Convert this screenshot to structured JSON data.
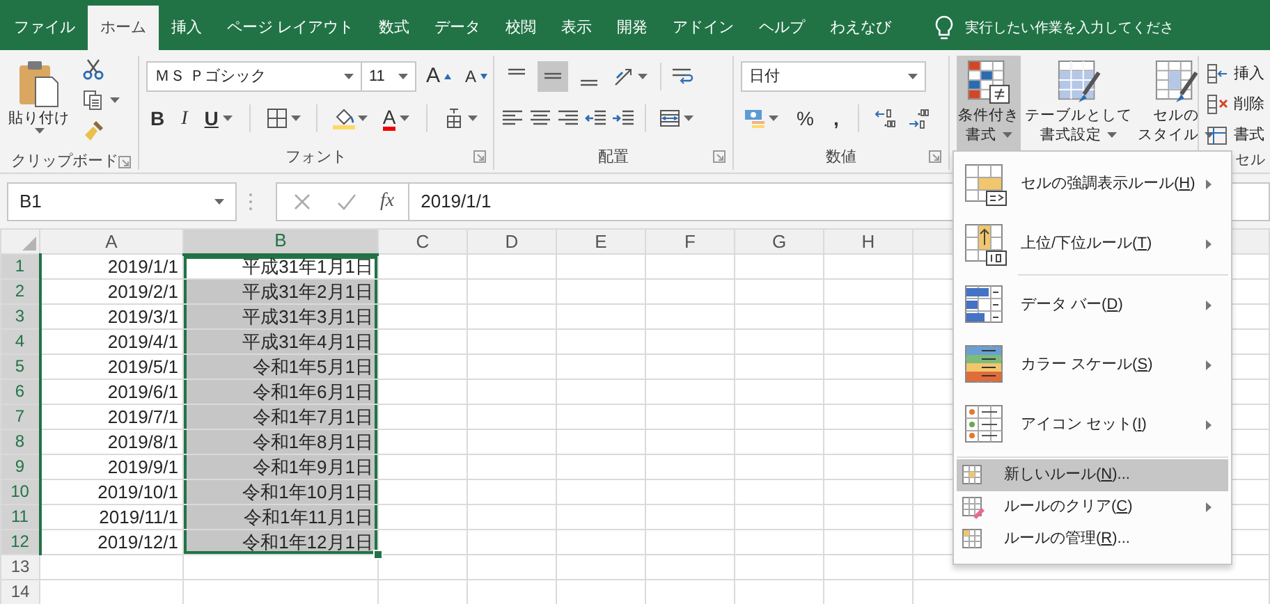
{
  "tabs": [
    {
      "label": "ファイル",
      "selected": false
    },
    {
      "label": "ホーム",
      "selected": true
    },
    {
      "label": "挿入",
      "selected": false
    },
    {
      "label": "ページ レイアウト",
      "selected": false
    },
    {
      "label": "数式",
      "selected": false
    },
    {
      "label": "データ",
      "selected": false
    },
    {
      "label": "校閲",
      "selected": false
    },
    {
      "label": "表示",
      "selected": false
    },
    {
      "label": "開発",
      "selected": false
    },
    {
      "label": "アドイン",
      "selected": false
    },
    {
      "label": "ヘルプ",
      "selected": false
    },
    {
      "label": "わえなび",
      "selected": false
    }
  ],
  "tell_me": {
    "placeholder": "実行したい作業を入力してくださ"
  },
  "ribbon": {
    "clipboard": {
      "paste": "貼り付け",
      "label": "クリップボード"
    },
    "font": {
      "font_name": "ＭＳ Ｐゴシック",
      "font_size": "11",
      "grow": "A",
      "shrink": "A",
      "bold": "B",
      "italic": "I",
      "underline": "U",
      "font_color": "A",
      "label": "フォント"
    },
    "alignment": {
      "vertical": [
        {
          "pressed": false
        },
        {
          "pressed": true
        },
        {
          "pressed": false
        }
      ],
      "label": "配置"
    },
    "number": {
      "format": "日付",
      "percent": "%",
      "comma": ",",
      "label": "数値"
    },
    "styles": {
      "buttons": [
        {
          "lines": [
            "条件付き",
            "書式"
          ],
          "pressed": true
        },
        {
          "lines": [
            "テーブルとして",
            "書式設定"
          ],
          "pressed": false
        },
        {
          "lines": [
            "セルの",
            "スタイル"
          ],
          "pressed": false
        }
      ]
    },
    "cells": {
      "items": [
        "挿入",
        "削除",
        "書式"
      ],
      "label": "セル"
    }
  },
  "formula_bar": {
    "name_box": "B1",
    "function_button": "fx",
    "value": "2019/1/1"
  },
  "sheet": {
    "columns": [
      {
        "label": "A",
        "selected": false
      },
      {
        "label": "B",
        "selected": true
      },
      {
        "label": "C",
        "selected": false
      },
      {
        "label": "D",
        "selected": false
      },
      {
        "label": "E",
        "selected": false
      },
      {
        "label": "F",
        "selected": false
      },
      {
        "label": "G",
        "selected": false
      },
      {
        "label": "H",
        "selected": false
      }
    ],
    "rows": [
      {
        "header": "1",
        "selected": true,
        "cells": [
          {
            "text": "2019/1/1",
            "selected": false
          },
          {
            "text": "平成31年1月1日",
            "selected": false
          }
        ]
      },
      {
        "header": "2",
        "selected": true,
        "cells": [
          {
            "text": "2019/2/1",
            "selected": false
          },
          {
            "text": "平成31年2月1日",
            "selected": true
          }
        ]
      },
      {
        "header": "3",
        "selected": true,
        "cells": [
          {
            "text": "2019/3/1",
            "selected": false
          },
          {
            "text": "平成31年3月1日",
            "selected": true
          }
        ]
      },
      {
        "header": "4",
        "selected": true,
        "cells": [
          {
            "text": "2019/4/1",
            "selected": false
          },
          {
            "text": "平成31年4月1日",
            "selected": true
          }
        ]
      },
      {
        "header": "5",
        "selected": true,
        "cells": [
          {
            "text": "2019/5/1",
            "selected": false
          },
          {
            "text": "令和1年5月1日",
            "selected": true
          }
        ]
      },
      {
        "header": "6",
        "selected": true,
        "cells": [
          {
            "text": "2019/6/1",
            "selected": false
          },
          {
            "text": "令和1年6月1日",
            "selected": true
          }
        ]
      },
      {
        "header": "7",
        "selected": true,
        "cells": [
          {
            "text": "2019/7/1",
            "selected": false
          },
          {
            "text": "令和1年7月1日",
            "selected": true
          }
        ]
      },
      {
        "header": "8",
        "selected": true,
        "cells": [
          {
            "text": "2019/8/1",
            "selected": false
          },
          {
            "text": "令和1年8月1日",
            "selected": true
          }
        ]
      },
      {
        "header": "9",
        "selected": true,
        "cells": [
          {
            "text": "2019/9/1",
            "selected": false
          },
          {
            "text": "令和1年9月1日",
            "selected": true
          }
        ]
      },
      {
        "header": "10",
        "selected": true,
        "cells": [
          {
            "text": "2019/10/1",
            "selected": false
          },
          {
            "text": "令和1年10月1日",
            "selected": true
          }
        ]
      },
      {
        "header": "11",
        "selected": true,
        "cells": [
          {
            "text": "2019/11/1",
            "selected": false
          },
          {
            "text": "令和1年11月1日",
            "selected": true
          }
        ]
      },
      {
        "header": "12",
        "selected": true,
        "cells": [
          {
            "text": "2019/12/1",
            "selected": false
          },
          {
            "text": "令和1年12月1日",
            "selected": true
          }
        ]
      },
      {
        "header": "13",
        "selected": false
      },
      {
        "header": "14",
        "selected": false
      }
    ]
  },
  "menu": {
    "sections": [
      {
        "items": [
          {
            "kind": "large",
            "label": "セルの強調表示ルール(H)",
            "submenu": true,
            "selected": false
          },
          {
            "kind": "large",
            "label": "上位/下位ルール(T)",
            "submenu": true,
            "selected": false
          }
        ]
      },
      {
        "items": [
          {
            "kind": "large",
            "label": "データ バー(D)",
            "submenu": true,
            "selected": false
          },
          {
            "kind": "large",
            "label": "カラー スケール(S)",
            "submenu": true,
            "selected": false
          },
          {
            "kind": "large",
            "label": "アイコン セット(I)",
            "submenu": true,
            "selected": false
          }
        ]
      },
      {
        "items": [
          {
            "kind": "small",
            "label": "新しいルール(N)...",
            "submenu": false,
            "selected": true
          },
          {
            "kind": "small",
            "label": "ルールのクリア(C)",
            "submenu": true,
            "selected": false
          },
          {
            "kind": "small",
            "label": "ルールの管理(R)...",
            "submenu": false,
            "selected": false
          }
        ]
      }
    ]
  }
}
